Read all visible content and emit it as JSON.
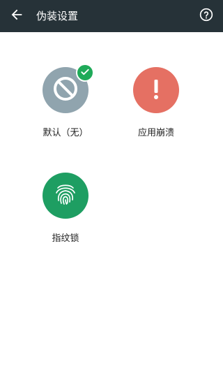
{
  "toolbar": {
    "title": "伪装设置",
    "back_icon": "arrow-left-icon",
    "help_icon": "help-circle-icon",
    "background": "#263238"
  },
  "options": [
    {
      "label": "默认（无）",
      "icon": "no-entry-icon",
      "color": "#90a4ae",
      "selected": true
    },
    {
      "label": "应用崩溃",
      "icon": "exclamation-icon",
      "color": "#e57063",
      "selected": false
    },
    {
      "label": "指纹锁",
      "icon": "fingerprint-icon",
      "color": "#1e9e62",
      "selected": false
    }
  ],
  "colors": {
    "selected_badge": "#1faa59"
  }
}
